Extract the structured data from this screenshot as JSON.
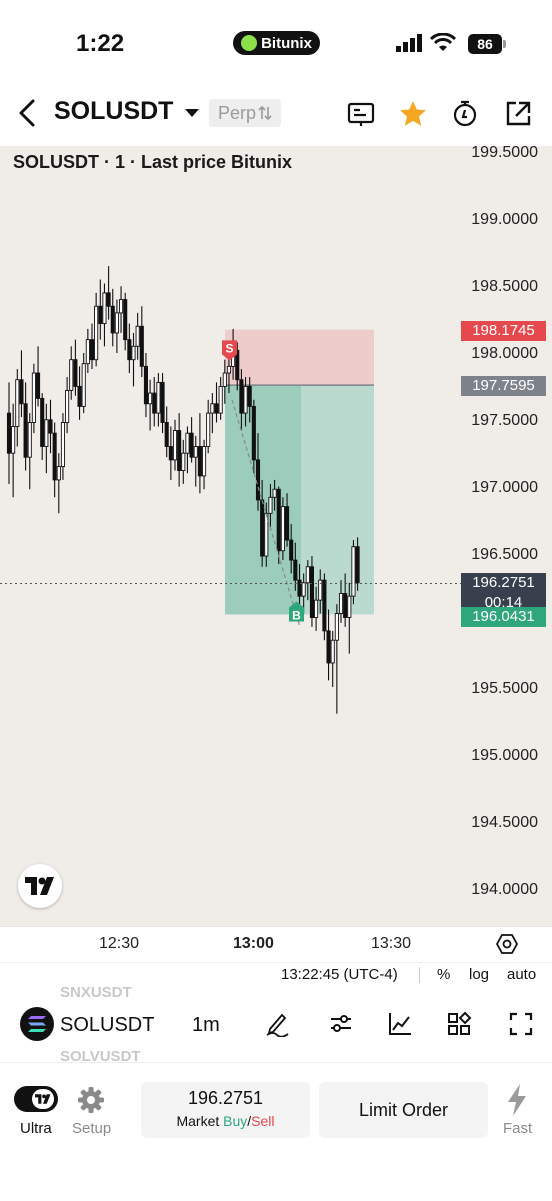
{
  "status_bar": {
    "time": "1:22",
    "carrier_pill": "Bitunix",
    "battery": "86"
  },
  "header": {
    "symbol": "SOLUSDT",
    "contract_type": "Perp",
    "icons": [
      "back-icon",
      "caret-down-icon",
      "swap-icon",
      "note-icon",
      "star-icon",
      "timer-icon",
      "share-icon"
    ],
    "favorite_color": "#f5a623"
  },
  "chart": {
    "legend": "SOLUSDT · 1 · Last price Bitunix",
    "y_ticks": [
      "199.5000",
      "199.0000",
      "198.5000",
      "198.0000",
      "197.5000",
      "197.0000",
      "196.5000",
      "196.0000",
      "195.5000",
      "195.0000",
      "194.5000",
      "194.0000"
    ],
    "x_ticks": [
      "12:30",
      "13:00",
      "13:30"
    ],
    "stop_price": "198.1745",
    "entry_price": "197.7595",
    "current_price": "196.2751",
    "countdown": "00:14",
    "target_price": "196.0431",
    "sell_marker": "S",
    "buy_marker": "B",
    "colors": {
      "background": "#f0ece8",
      "stop_zone": "#eec9c9",
      "target_zone": "#b7d9cd",
      "stop_label": "#e5484d",
      "entry_label": "#7e828a",
      "target_label": "#2fa77c",
      "current_label": "#37404c"
    }
  },
  "chart_data": {
    "type": "candlestick",
    "series_ohlc": [
      [
        197.55,
        197.78,
        197.02,
        197.25
      ],
      [
        197.25,
        197.62,
        196.92,
        197.45
      ],
      [
        197.45,
        197.88,
        197.3,
        197.8
      ],
      [
        197.8,
        198.02,
        197.52,
        197.62
      ],
      [
        197.62,
        197.78,
        197.12,
        197.22
      ],
      [
        197.22,
        197.55,
        196.98,
        197.48
      ],
      [
        197.48,
        197.92,
        197.4,
        197.85
      ],
      [
        197.85,
        198.05,
        197.6,
        197.66
      ],
      [
        197.66,
        197.7,
        197.2,
        197.3
      ],
      [
        197.3,
        197.62,
        197.1,
        197.5
      ],
      [
        197.5,
        197.65,
        197.25,
        197.4
      ],
      [
        197.4,
        197.48,
        196.92,
        197.05
      ],
      [
        197.05,
        197.25,
        196.8,
        197.15
      ],
      [
        197.15,
        197.55,
        197.05,
        197.48
      ],
      [
        197.48,
        197.82,
        197.4,
        197.72
      ],
      [
        197.72,
        198.05,
        197.65,
        197.95
      ],
      [
        197.95,
        198.1,
        197.68,
        197.75
      ],
      [
        197.75,
        197.9,
        197.5,
        197.6
      ],
      [
        197.6,
        198.0,
        197.55,
        197.92
      ],
      [
        197.92,
        198.18,
        197.85,
        198.1
      ],
      [
        198.1,
        198.22,
        197.88,
        197.95
      ],
      [
        197.95,
        198.45,
        197.9,
        198.35
      ],
      [
        198.35,
        198.55,
        198.1,
        198.22
      ],
      [
        198.22,
        198.52,
        198.05,
        198.45
      ],
      [
        198.45,
        198.65,
        198.25,
        198.35
      ],
      [
        198.35,
        198.48,
        198.05,
        198.15
      ],
      [
        198.15,
        198.4,
        198.0,
        198.3
      ],
      [
        198.3,
        198.5,
        198.15,
        198.4
      ],
      [
        198.4,
        198.45,
        198.02,
        198.1
      ],
      [
        198.1,
        198.22,
        197.85,
        197.95
      ],
      [
        197.95,
        198.15,
        197.75,
        198.05
      ],
      [
        198.05,
        198.3,
        197.95,
        198.2
      ],
      [
        198.2,
        198.35,
        197.82,
        197.9
      ],
      [
        197.9,
        198.0,
        197.52,
        197.62
      ],
      [
        197.62,
        197.8,
        197.42,
        197.7
      ],
      [
        197.7,
        197.82,
        197.45,
        197.55
      ],
      [
        197.55,
        197.85,
        197.45,
        197.78
      ],
      [
        197.78,
        197.85,
        197.4,
        197.48
      ],
      [
        197.48,
        197.6,
        197.22,
        197.3
      ],
      [
        197.3,
        197.45,
        197.05,
        197.2
      ],
      [
        197.2,
        197.5,
        197.12,
        197.42
      ],
      [
        197.42,
        197.55,
        197.0,
        197.12
      ],
      [
        197.12,
        197.35,
        197.02,
        197.25
      ],
      [
        197.25,
        197.45,
        197.1,
        197.4
      ],
      [
        197.4,
        197.52,
        197.18,
        197.22
      ],
      [
        197.22,
        197.38,
        197.0,
        197.3
      ],
      [
        197.3,
        197.55,
        196.95,
        197.08
      ],
      [
        197.08,
        197.35,
        196.98,
        197.3
      ],
      [
        197.3,
        197.65,
        197.25,
        197.55
      ],
      [
        197.55,
        197.7,
        197.4,
        197.62
      ],
      [
        197.62,
        197.78,
        197.48,
        197.55
      ],
      [
        197.55,
        197.82,
        197.5,
        197.75
      ],
      [
        197.75,
        197.95,
        197.62,
        197.85
      ],
      [
        197.85,
        198.0,
        197.7,
        197.9
      ],
      [
        197.9,
        198.18,
        197.8,
        198.02
      ],
      [
        198.02,
        198.08,
        197.72,
        197.8
      ],
      [
        197.8,
        197.88,
        197.42,
        197.55
      ],
      [
        197.55,
        197.82,
        197.45,
        197.75
      ],
      [
        197.75,
        197.82,
        197.48,
        197.6
      ],
      [
        197.6,
        197.65,
        197.1,
        197.2
      ],
      [
        197.2,
        197.4,
        196.82,
        196.9
      ],
      [
        196.9,
        197.05,
        196.4,
        196.48
      ],
      [
        196.48,
        196.88,
        196.4,
        196.8
      ],
      [
        196.8,
        197.02,
        196.7,
        196.92
      ],
      [
        196.92,
        197.05,
        196.82,
        196.98
      ],
      [
        196.98,
        197.0,
        196.42,
        196.52
      ],
      [
        196.52,
        196.92,
        196.45,
        196.85
      ],
      [
        196.85,
        196.95,
        196.55,
        196.6
      ],
      [
        196.6,
        196.72,
        196.35,
        196.45
      ],
      [
        196.45,
        196.58,
        196.22,
        196.3
      ],
      [
        196.3,
        196.42,
        196.1,
        196.18
      ],
      [
        196.18,
        196.35,
        196.05,
        196.28
      ],
      [
        196.28,
        196.45,
        196.15,
        196.4
      ],
      [
        196.4,
        196.48,
        195.95,
        196.02
      ],
      [
        196.02,
        196.25,
        195.92,
        196.15
      ],
      [
        196.15,
        196.38,
        196.05,
        196.3
      ],
      [
        196.3,
        196.35,
        195.85,
        195.92
      ],
      [
        195.92,
        196.08,
        195.55,
        195.68
      ],
      [
        195.68,
        195.92,
        195.5,
        195.85
      ],
      [
        195.85,
        196.12,
        195.3,
        196.05
      ],
      [
        196.05,
        196.3,
        195.98,
        196.2
      ],
      [
        196.2,
        196.35,
        195.95,
        196.02
      ],
      [
        196.02,
        196.28,
        195.75,
        196.18
      ],
      [
        196.18,
        196.6,
        196.12,
        196.55
      ],
      [
        196.55,
        196.62,
        196.22,
        196.28
      ]
    ],
    "ylim": [
      193.9,
      199.6
    ],
    "x_ticks": [
      "12:30",
      "13:00",
      "13:30"
    ]
  },
  "footer": {
    "timestamp": "13:22:45 (UTC-4)",
    "percent": "%",
    "log": "log",
    "auto": "auto"
  },
  "toolbar": {
    "ghost_above": "SNXUSDT",
    "symbol": "SOLUSDT",
    "ghost_below": "SOLVUSDT",
    "interval": "1m",
    "icons": [
      "solana-logo-icon",
      "drawing-pen-icon",
      "indicator-settings-icon",
      "chart-line-icon",
      "layout-grid-icon",
      "fullscreen-icon"
    ]
  },
  "bottom": {
    "ultra_label": "Ultra",
    "setup_label": "Setup",
    "market_price": "196.2751",
    "market_prefix": "Market ",
    "buy": "Buy",
    "slash": "/",
    "sell": "Sell",
    "buy_color": "#2fa77c",
    "sell_color": "#e5484d",
    "limit_label": "Limit Order",
    "fast_label": "Fast"
  }
}
